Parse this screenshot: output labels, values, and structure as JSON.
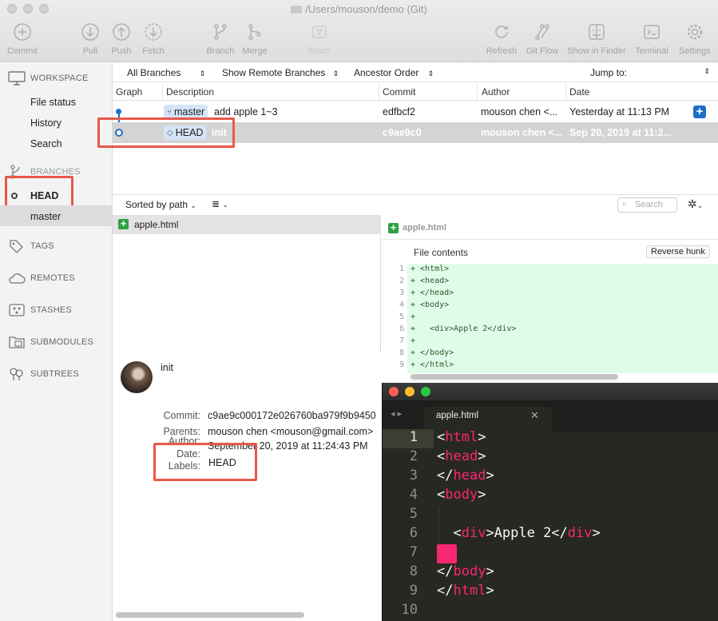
{
  "window": {
    "title": "/Users/mouson/demo (Git)"
  },
  "toolbar": {
    "commit": "Commit",
    "pull": "Pull",
    "push": "Push",
    "fetch": "Fetch",
    "branch": "Branch",
    "merge": "Merge",
    "stash": "Stash",
    "refresh": "Refresh",
    "git_flow": "Git Flow",
    "show_in_finder": "Show in Finder",
    "terminal": "Terminal",
    "settings": "Settings"
  },
  "sidebar": {
    "workspace": "WORKSPACE",
    "workspace_items": [
      "File status",
      "History",
      "Search"
    ],
    "branches": "BRANCHES",
    "branch_items": [
      "HEAD",
      "master"
    ],
    "tags": "TAGS",
    "remotes": "REMOTES",
    "stashes": "STASHES",
    "submodules": "SUBMODULES",
    "subtrees": "SUBTREES"
  },
  "filters": {
    "branches": "All Branches",
    "remote": "Show Remote Branches",
    "order": "Ancestor Order",
    "jump_to": "Jump to:"
  },
  "columns": {
    "graph": "Graph",
    "description": "Description",
    "commit": "Commit",
    "author": "Author",
    "date": "Date"
  },
  "commits": [
    {
      "tag": "master",
      "message": "add apple 1~3",
      "hash": "edfbcf2",
      "author": "mouson chen <...",
      "date": "Yesterday at 11:13 PM"
    },
    {
      "tag": "HEAD",
      "message": "init",
      "hash": "c9ae9c0",
      "author": "mouson chen <...",
      "date": "Sep 20, 2019 at 11:2..."
    }
  ],
  "files": {
    "sort": "Sorted by path",
    "search_placeholder": "Search",
    "items": [
      "apple.html"
    ]
  },
  "diff": {
    "filename": "apple.html",
    "hunk_title": "File contents",
    "reverse_hunk": "Reverse hunk",
    "lines": [
      {
        "n": "1",
        "t": "+ <html>"
      },
      {
        "n": "2",
        "t": "+ <head>"
      },
      {
        "n": "3",
        "t": "+ </head>"
      },
      {
        "n": "4",
        "t": "+ <body>"
      },
      {
        "n": "5",
        "t": "+"
      },
      {
        "n": "6",
        "t": "+   <div>Apple 2</div>"
      },
      {
        "n": "7",
        "t": "+"
      },
      {
        "n": "8",
        "t": "+ </body>"
      },
      {
        "n": "9",
        "t": "+ </html>"
      }
    ]
  },
  "details": {
    "subject": "init",
    "commit_label": "Commit:",
    "commit": "c9ae9c000172e026760ba979f9b9450",
    "parents_label": "Parents:",
    "parents": "mouson chen <mouson@gmail.com>",
    "author_label": "Author:",
    "date_label": "Date:",
    "date": "September 20, 2019 at 11:24:43 PM",
    "labels_label": "Labels:",
    "labels": "HEAD"
  },
  "editor": {
    "tab": "apple.html",
    "line_numbers": [
      "1",
      "2",
      "3",
      "4",
      "5",
      "6",
      "7",
      "8",
      "9",
      "10"
    ]
  }
}
